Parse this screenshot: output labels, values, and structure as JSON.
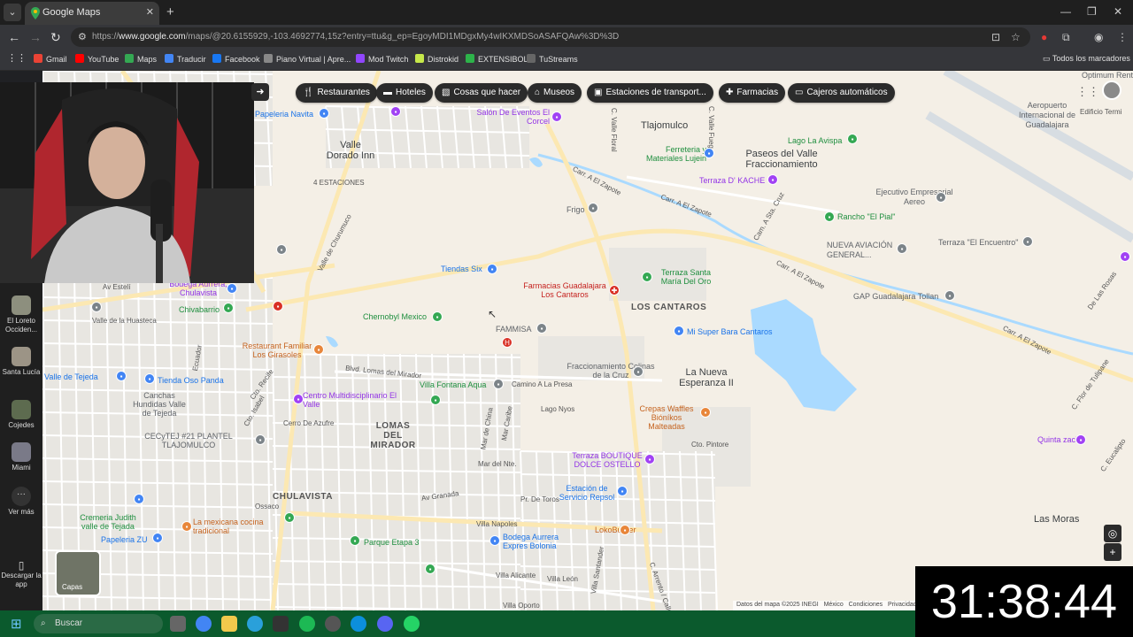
{
  "browser": {
    "tab_title": "Google Maps",
    "url_prefix": "https://",
    "url_host": "www.google.com",
    "url_rest": "/maps/@20.6155929,-103.4692774,15z?entry=ttu&g_ep=EgoyMDI1MDgxMy4wIKXMDSoASAFQAw%3D%3D",
    "bookmarks": [
      "Gmail",
      "YouTube",
      "Maps",
      "Traducir",
      "Facebook",
      "Piano Virtual | Apre...",
      "Mod Twitch",
      "Distrokid",
      "EXTENSIBOL",
      "TuStreams"
    ],
    "all_bookmarks": "Todos los marcadores"
  },
  "chips": [
    "Restaurantes",
    "Hoteles",
    "Cosas que hacer",
    "Museos",
    "Estaciones de transport...",
    "Farmacias",
    "Cajeros automáticos"
  ],
  "places": {
    "papeleria_navita": "Papeleria Navita",
    "salon": "Salón De Eventos El Corcel",
    "tlajomulco": "Tlajomulco",
    "valle_dorado": "Valle Dorado Inn",
    "cuatro_estaciones": "4 ESTACIONES",
    "ferreteria": "Ferreteria y Materiales Lujein",
    "paseos": "Paseos del Valle Fraccionamiento",
    "lago_avispa": "Lago La Avispa",
    "aeropuerto": "Aeropuerto Internacional de Guadalajara",
    "optimum": "Optimum Rent",
    "edificio": "Edificio Termi",
    "terraza_kache": "Terraza D' KACHE",
    "frigo": "Frigo",
    "ejecutivo": "Ejecutivo Empresarial Aereo",
    "rancho": "Rancho \"El Pial\"",
    "nueva_aviacion": "NUEVA AVIACIÓN GENERAL...",
    "terraza_encuentro": "Terraza \"El Encuentro\"",
    "tiendas_six": "Tiendas Six",
    "terraza_santa": "Terraza Santa María Del Oro",
    "farmacias_gdl": "Farmacias Guadalajara Los Cantaros",
    "gap": "GAP Guadalajara Tollan",
    "los_cantaros": "LOS CANTAROS",
    "bodega_chulavista": "Bodega Aurrera, Chulavista",
    "chivabarrio": "Chivabarrio",
    "chernobyl": "Chernobyl Mexico",
    "famisa": "FAMMISA",
    "mi_super": "Mi Super Bara Cantaros",
    "restaurant_girasoles": "Restaurant Familiar Los Girasoles",
    "fracc_colinas": "Fraccionamiento Colinas de la Cruz",
    "nueva_esperanza": "La Nueva Esperanza II",
    "valle_huasteca": "Valle de la Huasteca",
    "valle_tejeda": "Valle de Tejeda",
    "tienda_oso": "Tienda Oso Panda",
    "centro_multi": "Centro Multidisciplinario El Valle",
    "villa_fontana": "Villa Fontana Aqua",
    "camino_presa": "Camino A La Presa",
    "lago_nyos": "Lago Nyos",
    "crepas": "Crepas Waffles Bióníkos Malteadas",
    "quinta_zach": "Quinta zach",
    "canchas": "Canchas Hundidas Valle de Tejeda",
    "cecytej": "CECyTEJ #21 PLANTEL TLAJOMULCO",
    "lomas_mirador": "LOMAS DEL MIRADOR",
    "terraza_boutique": "Terraza BOUTIQUE DOLCE OSTELLO",
    "estacion_repsol": "Estación de Servicio Repsol",
    "cremeria": "Cremeria Judith valle de Tejada",
    "chulavista": "CHULAVISTA",
    "lokoburger": "LokoBurger",
    "las_moras": "Las Moras",
    "mexicana": "La mexicana cocina tradicional",
    "papeleria_zu": "Papeleria ZU",
    "parque_etapa": "Parque Etapa 3",
    "bodega_bolonia": "Bodega Aurrera Expres Bolonia",
    "el_loreto": "El Loreto Occiden...",
    "santa_lucia": "Santa Lucía",
    "cojedes": "Cojedes",
    "miami": "Miami",
    "ver_mas": "Ver más",
    "descargar": "Descargar la app"
  },
  "roads": {
    "carr_zapote_1": "Carr. A El Zapote",
    "carr_zapote_2": "Carr. A El Zapote",
    "carr_zapote_3": "Carr. A El Zapote",
    "carr_zapote_4": "Carr. A El Zapote",
    "blvd_lomas": "Blvd. Lomas del Mirador",
    "av_granada": "Av Granada",
    "pr_toros": "Pr. De Toros",
    "av_estelí": "Av Estelí",
    "c_valle_floral": "C. Valle Floral",
    "c_valle_fuego": "C. Valle Fuego",
    "valle_churumuco": "Valle de Churumuco",
    "mar_del_nte": "Mar del Nte.",
    "cto_pintore": "Cto. Pintore",
    "villa_napoles": "Villa Napoles",
    "villa_alicante": "Villa Alicante",
    "villa_leon": "Villa León",
    "villa_oporto": "Villa Oporto",
    "de_las_rosas": "De Las Rosas",
    "ecuador": "Ecuador",
    "c_eucalipto": "C. Eucalipto",
    "mar_de_china": "Mar de China",
    "mar_caribe": "Mar Caribe",
    "cerro_azufre": "Cerro De Azufre",
    "ossaco": "Ossaco",
    "av_arrento": "C. Arrento / Calle",
    "c_flor_tulipane": "C. Flor de Tulipane",
    "cto_recife": "Cto. Recife",
    "cto_isabel": "Cto. Isabel"
  },
  "rail_thumbs_colors": [
    "#8d8f7e",
    "#9c9486",
    "#5d6b4f",
    "#7a7a88"
  ],
  "controls": {
    "layers": "Capas",
    "attribution_data": "Datos del mapa ©2025 INEGI",
    "attribution_mexico": "México",
    "attribution_conditions": "Condiciones",
    "attribution_privacy": "Privacidad"
  },
  "timer": "31:38:44",
  "taskbar": {
    "search_label": "Buscar"
  },
  "colors": {
    "map_bg": "#f4efe6",
    "water": "#aadaff",
    "road_minor": "#ffffff",
    "road_major": "#fbe2a1",
    "chip_bg": "#2b2b2b"
  }
}
